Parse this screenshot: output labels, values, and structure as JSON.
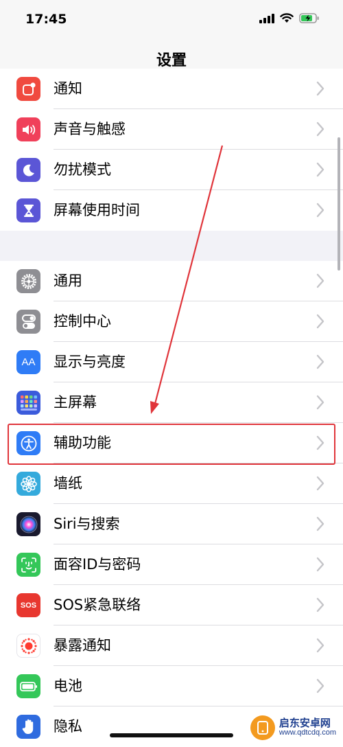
{
  "status_bar": {
    "time": "17:45"
  },
  "nav": {
    "title": "设置"
  },
  "colors": {
    "notifications": "#f04a3f",
    "sounds": "#f0405a",
    "dnd": "#5b56d6",
    "screen_time": "#5b56d6",
    "general": "#8e8e93",
    "control_center": "#8e8e93",
    "display": "#2f7cf6",
    "home_screen": "#3b5bdb",
    "accessibility": "#2f7cf6",
    "wallpaper": "#34aadc",
    "siri": "#1a1a2e",
    "face_id": "#34c759",
    "sos": "#e8372f",
    "exposure": "#ffffff",
    "battery": "#34c759",
    "privacy": "#2f6bdf",
    "highlight": "#e0343a"
  },
  "section_1": [
    {
      "label": "通知",
      "icon": "notification-icon"
    },
    {
      "label": "声音与触感",
      "icon": "speaker-icon"
    },
    {
      "label": "勿扰模式",
      "icon": "moon-icon"
    },
    {
      "label": "屏幕使用时间",
      "icon": "hourglass-icon"
    }
  ],
  "section_2": [
    {
      "label": "通用",
      "icon": "gear-icon"
    },
    {
      "label": "控制中心",
      "icon": "toggles-icon"
    },
    {
      "label": "显示与亮度",
      "icon": "aa-icon",
      "icon_text": "AA"
    },
    {
      "label": "主屏幕",
      "icon": "app-grid-icon"
    },
    {
      "label": "辅助功能",
      "icon": "accessibility-icon"
    },
    {
      "label": "墙纸",
      "icon": "flower-icon"
    },
    {
      "label": "Siri与搜索",
      "icon": "siri-icon"
    },
    {
      "label": "面容ID与密码",
      "icon": "face-id-icon"
    },
    {
      "label": "SOS紧急联络",
      "icon": "sos-icon",
      "icon_text": "SOS"
    },
    {
      "label": "暴露通知",
      "icon": "exposure-icon"
    },
    {
      "label": "电池",
      "icon": "battery-icon"
    },
    {
      "label": "隐私",
      "icon": "hand-icon"
    }
  ],
  "watermark": {
    "name": "启东安卓网",
    "url": "www.qdtcdq.com"
  }
}
